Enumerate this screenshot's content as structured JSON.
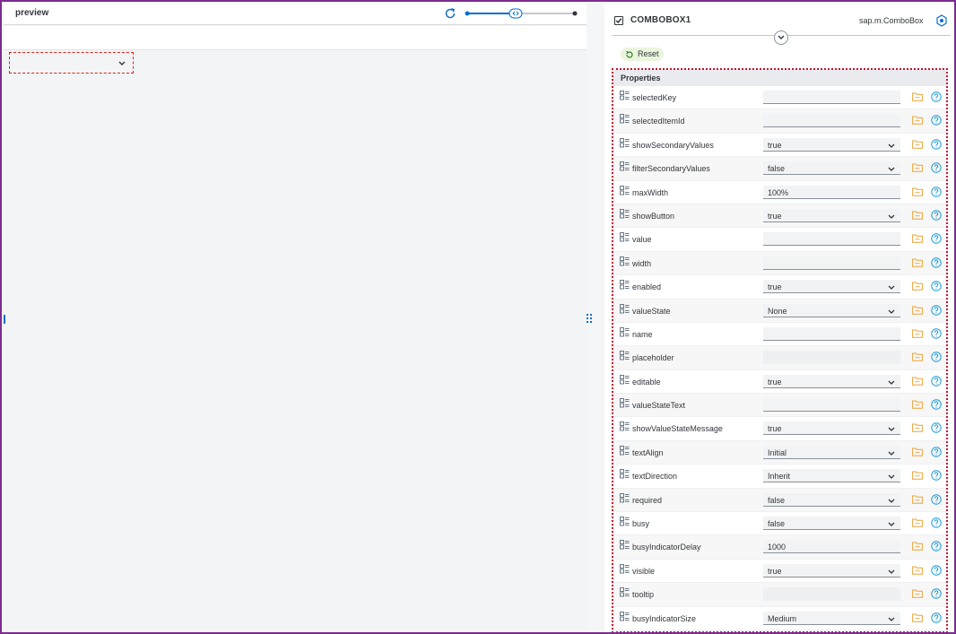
{
  "preview": {
    "title": "preview",
    "zoom_level_fraction": 0.45
  },
  "inspector": {
    "control_name": "COMBOBOX1",
    "control_type": "sap.m.ComboBox",
    "reset_label": "Reset",
    "section_title": "Properties",
    "properties": [
      {
        "name": "selectedKey",
        "value": "",
        "kind": "text"
      },
      {
        "name": "selectedItemId",
        "value": "",
        "kind": "text"
      },
      {
        "name": "showSecondaryValues",
        "value": "true",
        "kind": "select"
      },
      {
        "name": "filterSecondaryValues",
        "value": "false",
        "kind": "select"
      },
      {
        "name": "maxWidth",
        "value": "100%",
        "kind": "text"
      },
      {
        "name": "showButton",
        "value": "true",
        "kind": "select"
      },
      {
        "name": "value",
        "value": "",
        "kind": "text"
      },
      {
        "name": "width",
        "value": "",
        "kind": "text"
      },
      {
        "name": "enabled",
        "value": "true",
        "kind": "select"
      },
      {
        "name": "valueState",
        "value": "None",
        "kind": "select"
      },
      {
        "name": "name",
        "value": "",
        "kind": "text"
      },
      {
        "name": "placeholder",
        "value": "",
        "kind": "plain"
      },
      {
        "name": "editable",
        "value": "true",
        "kind": "select"
      },
      {
        "name": "valueStateText",
        "value": "",
        "kind": "text"
      },
      {
        "name": "showValueStateMessage",
        "value": "true",
        "kind": "select"
      },
      {
        "name": "textAlign",
        "value": "Initial",
        "kind": "select"
      },
      {
        "name": "textDirection",
        "value": "Inherit",
        "kind": "select"
      },
      {
        "name": "required",
        "value": "false",
        "kind": "select"
      },
      {
        "name": "busy",
        "value": "false",
        "kind": "select"
      },
      {
        "name": "busyIndicatorDelay",
        "value": "1000",
        "kind": "text"
      },
      {
        "name": "visible",
        "value": "true",
        "kind": "select"
      },
      {
        "name": "tooltip",
        "value": "",
        "kind": "plain"
      },
      {
        "name": "busyIndicatorSize",
        "value": "Medium",
        "kind": "select"
      }
    ]
  },
  "colors": {
    "accent_blue": "#0a6ed1",
    "frame_purple": "#7b2d8e",
    "highlight_red": "#c8102e",
    "bind_folder": "#e9a33a",
    "help_teal": "#1a9bd7",
    "reset_green_bg": "#eaf5dd"
  },
  "icons": {
    "refresh": "refresh-icon",
    "checkbox": "checkbox-checked-icon",
    "type": "control-type-icon",
    "collapse": "chevron-down-icon",
    "reset": "reset-icon",
    "property": "property-icon",
    "bind": "folder-bind-icon",
    "help": "help-icon"
  }
}
